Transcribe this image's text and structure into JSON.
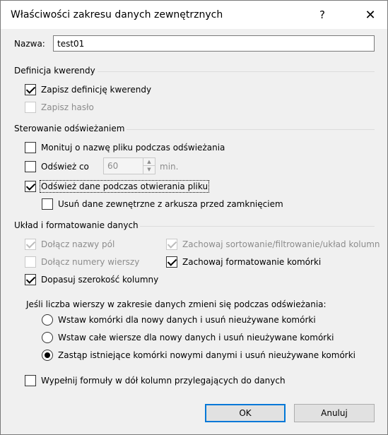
{
  "window": {
    "title": "Właściwości zakresu danych zewnętrznych",
    "help_glyph": "?",
    "close_glyph": "✕"
  },
  "name_field": {
    "label": "Nazwa:",
    "value": "test01"
  },
  "query_definition": {
    "title": "Definicja kwerendy",
    "save_query": {
      "label": "Zapisz definicję kwerendy",
      "checked": true,
      "disabled": false
    },
    "save_password": {
      "label": "Zapisz hasło",
      "checked": false,
      "disabled": true
    }
  },
  "refresh_control": {
    "title": "Sterowanie odświeżaniem",
    "prompt_file": {
      "label": "Monituj o nazwę pliku podczas odświeżania",
      "checked": false
    },
    "refresh_every": {
      "label": "Odśwież co",
      "checked": false,
      "value": "60",
      "unit": "min."
    },
    "refresh_on_open": {
      "label": "Odśwież dane podczas otwierania pliku",
      "checked": true
    },
    "remove_external": {
      "label": "Usuń dane zewnętrzne z arkusza przed zamknięciem",
      "checked": false
    }
  },
  "layout": {
    "title": "Układ i formatowanie danych",
    "include_field_names": {
      "label": "Dołącz nazwy pól",
      "checked": true,
      "disabled": true
    },
    "keep_sort": {
      "label": "Zachowaj sortowanie/filtrowanie/układ kolumn",
      "checked": true,
      "disabled": true
    },
    "include_row_numbers": {
      "label": "Dołącz numery wierszy",
      "checked": false,
      "disabled": true
    },
    "keep_cell_format": {
      "label": "Zachowaj formatowanie komórki",
      "checked": true,
      "disabled": false
    },
    "adjust_width": {
      "label": "Dopasuj szerokość kolumny",
      "checked": true,
      "disabled": false
    },
    "rows_change_question": "Jeśli liczba wierszy w zakresie danych zmieni się podczas odświeżania:",
    "radio_options": [
      {
        "label": "Wstaw komórki dla nowy danych i usuń nieużywane komórki",
        "selected": false
      },
      {
        "label": "Wstaw całe wiersze dla nowy danych i usuń nieużywane komórki",
        "selected": false
      },
      {
        "label": "Zastąp istniejące komórki nowymi danymi i usuń nieużywane komórki",
        "selected": true
      }
    ],
    "fill_formulas": {
      "label": "Wypełnij formuły w dół kolumn przylegających do danych",
      "checked": false
    }
  },
  "buttons": {
    "ok": "OK",
    "cancel": "Anuluj"
  },
  "colors": {
    "accent": "#0078d7",
    "dialog_bg": "#f0f0f0"
  }
}
